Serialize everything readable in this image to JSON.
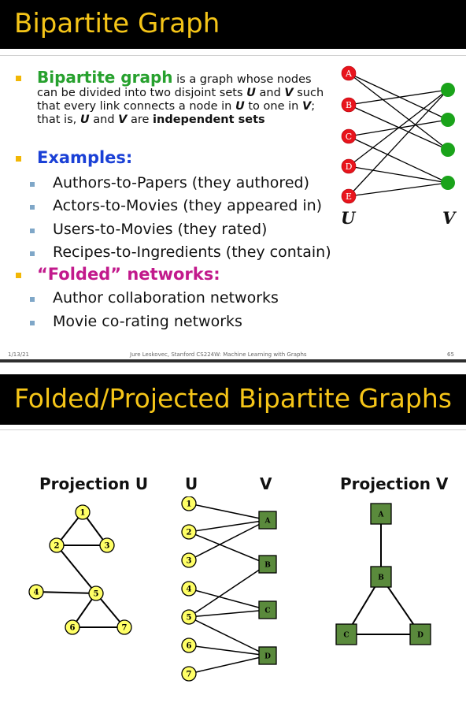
{
  "slide1": {
    "title": "Bipartite Graph",
    "definition": {
      "term": "Bipartite graph",
      "text_1": " is a graph whose nodes can be divided into two disjoint sets ",
      "set_u": "U",
      "text_2": " and ",
      "set_v": "V",
      "text_3": " such that every link connects a node in ",
      "text_4": " to one in ",
      "text_5": "; that is, ",
      "text_6": " are ",
      "independent": "independent sets"
    },
    "examples_heading": "Examples:",
    "examples": [
      "Authors-to-Papers (they authored)",
      "Actors-to-Movies (they appeared in)",
      "Users-to-Movies (they rated)",
      "Recipes-to-Ingredients (they contain)"
    ],
    "folded_heading": "“Folded” networks:",
    "folded_items": [
      "Author collaboration networks",
      "Movie co-rating networks"
    ],
    "graph": {
      "u_nodes": [
        "A",
        "B",
        "C",
        "D",
        "E"
      ],
      "u_label": "U",
      "v_label": "V",
      "edges": [
        [
          0,
          1
        ],
        [
          0,
          2
        ],
        [
          1,
          0
        ],
        [
          1,
          2
        ],
        [
          2,
          1
        ],
        [
          2,
          3
        ],
        [
          3,
          0
        ],
        [
          3,
          3
        ],
        [
          4,
          0
        ],
        [
          4,
          3
        ]
      ]
    },
    "footer_date": "1/13/21",
    "footer_center": "Jure Leskovec, Stanford CS224W: Machine Learning with Graphs",
    "page_number": "65"
  },
  "slide2": {
    "title": "Folded/Projected Bipartite Graphs",
    "projection_u_label": "Projection U",
    "projection_v_label": "Projection V",
    "u_label": "U",
    "v_label": "V",
    "u_nodes": [
      "1",
      "2",
      "3",
      "4",
      "5",
      "6",
      "7"
    ],
    "v_nodes": [
      "A",
      "B",
      "C",
      "D"
    ],
    "bipartite_edges": [
      [
        "1",
        "A"
      ],
      [
        "2",
        "A"
      ],
      [
        "2",
        "B"
      ],
      [
        "3",
        "A"
      ],
      [
        "4",
        "C"
      ],
      [
        "5",
        "B"
      ],
      [
        "5",
        "C"
      ],
      [
        "5",
        "D"
      ],
      [
        "6",
        "D"
      ],
      [
        "7",
        "D"
      ]
    ],
    "projection_u_edges": [
      [
        "1",
        "2"
      ],
      [
        "1",
        "3"
      ],
      [
        "2",
        "3"
      ],
      [
        "2",
        "5"
      ],
      [
        "4",
        "5"
      ],
      [
        "5",
        "6"
      ],
      [
        "5",
        "7"
      ],
      [
        "6",
        "7"
      ]
    ],
    "projection_v_edges": [
      [
        "A",
        "B"
      ],
      [
        "B",
        "C"
      ],
      [
        "B",
        "D"
      ],
      [
        "C",
        "D"
      ]
    ]
  },
  "colors": {
    "title_text": "#f5c518",
    "title_bar": "#000000",
    "term": "#27a12e",
    "examples": "#1a40d6",
    "folded": "#c21a8c",
    "u_node": "#e8141c",
    "v_node": "#1aa31a",
    "proj_u_node": "#ffff66",
    "proj_v_node": "#5a8a3c"
  }
}
